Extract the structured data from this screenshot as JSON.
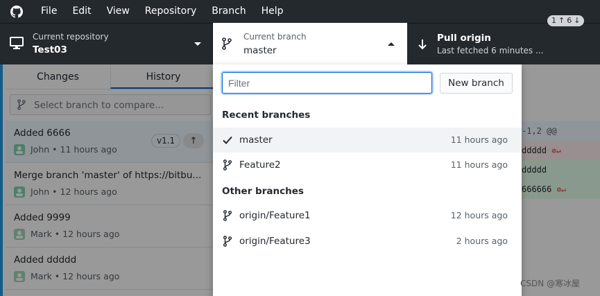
{
  "menubar": {
    "items": [
      "File",
      "Edit",
      "View",
      "Repository",
      "Branch",
      "Help"
    ]
  },
  "toolbar": {
    "repo_label": "Current repository",
    "repo_name": "Test03",
    "branch_label": "Current branch",
    "branch_name": "master",
    "pull_title": "Pull origin",
    "pull_subtitle": "Last fetched 6 minutes ...",
    "pull_badge_behind": "1",
    "pull_badge_ahead": "6"
  },
  "sidebar": {
    "tabs": [
      "Changes",
      "History"
    ],
    "active_tab": "History",
    "compare_placeholder": "Select branch to compare...",
    "commits": [
      {
        "title": "Added 6666",
        "author": "John",
        "time": "11 hours ago",
        "tag": "v1.1"
      },
      {
        "title": "Merge branch 'master' of https://bitbu...",
        "author": "John",
        "time": "12 hours ago"
      },
      {
        "title": "Added 9999",
        "author": "Mark",
        "time": "12 hours ago"
      },
      {
        "title": "Added ddddd",
        "author": "Mark",
        "time": "12 hours ago"
      }
    ]
  },
  "diff": {
    "lines": [
      "-1,2 @@",
      "ddddd",
      "ddddd",
      "666666"
    ]
  },
  "dropdown": {
    "filter_placeholder": "Filter",
    "new_branch_label": "New branch",
    "recent_header": "Recent branches",
    "other_header": "Other branches",
    "recent": [
      {
        "name": "master",
        "time": "11 hours ago",
        "current": true
      },
      {
        "name": "Feature2",
        "time": "11 hours ago"
      }
    ],
    "other": [
      {
        "name": "origin/Feature1",
        "time": "12 hours ago"
      },
      {
        "name": "origin/Feature3",
        "time": "2 hours ago"
      }
    ]
  },
  "watermark": "CSDN @寒冰屋",
  "colors": {
    "titlebar": "#24292e",
    "accent": "#0366d6",
    "sidebar_edge": "#1f9ce4"
  }
}
